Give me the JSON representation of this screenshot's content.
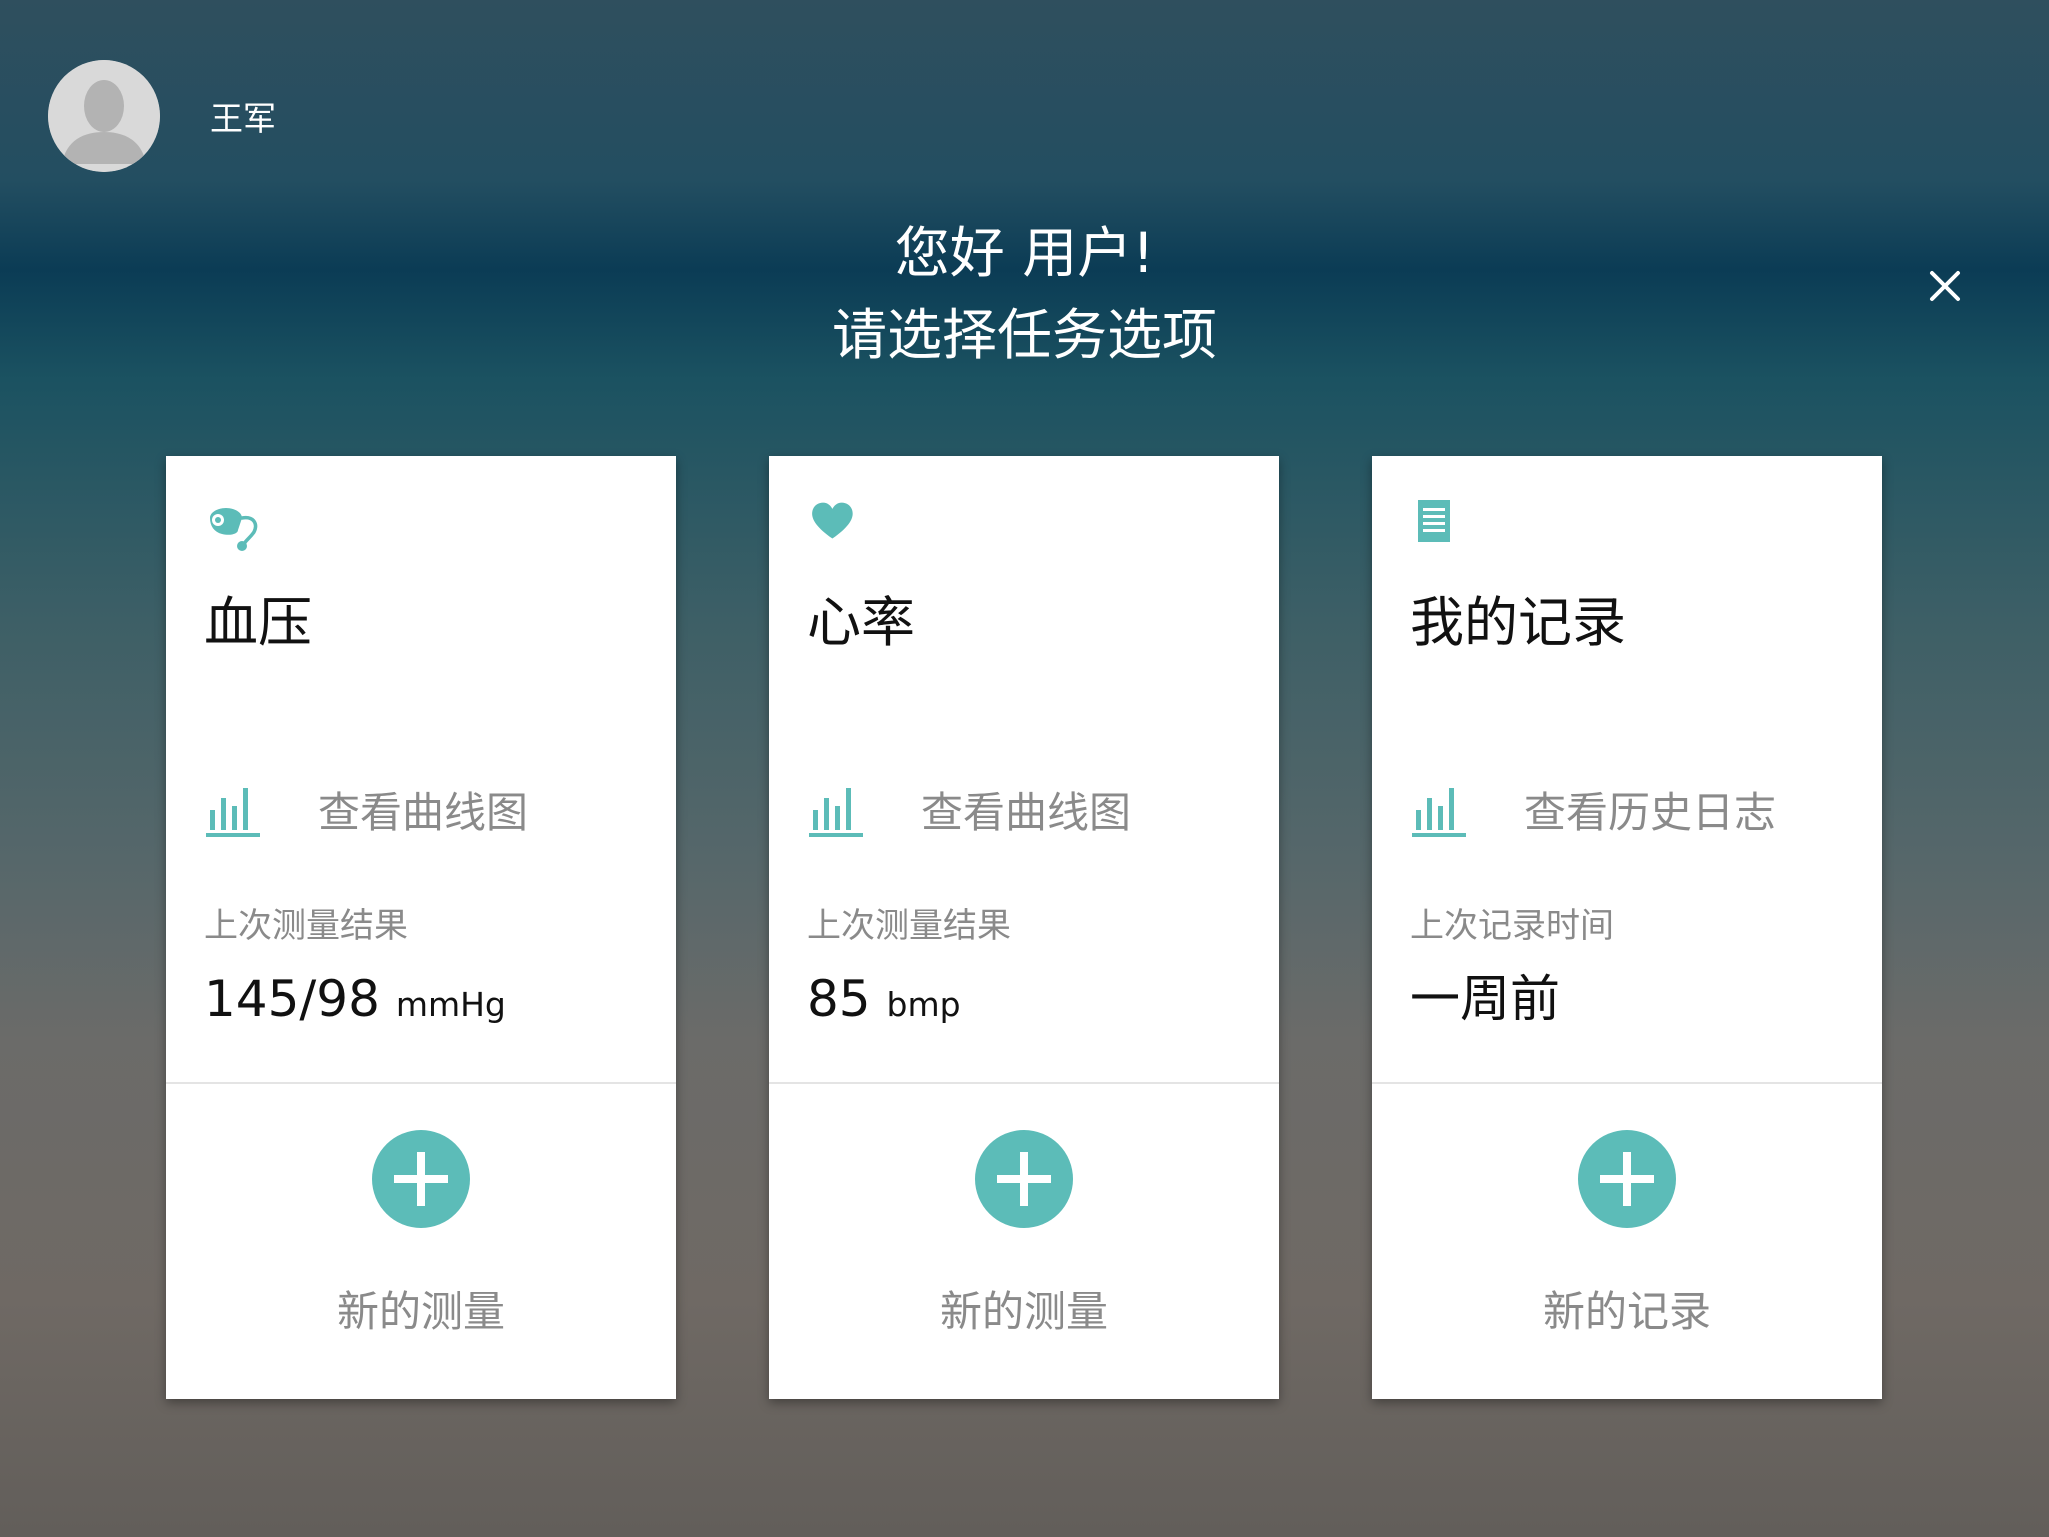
{
  "header": {
    "user_name": "王军",
    "greeting_line1": "您好 用户!",
    "greeting_line2": "请选择任务选项"
  },
  "colors": {
    "accent": "#5cbcb8",
    "card_bg": "#ffffff",
    "muted_text": "#8a8a8a"
  },
  "cards": [
    {
      "icon": "blood-pressure-cuff-icon",
      "title": "血压",
      "link_label": "查看曲线图",
      "last_label": "上次测量结果",
      "last_value": "145/98",
      "last_unit": "mmHg",
      "action_label": "新的测量"
    },
    {
      "icon": "heart-icon",
      "title": "心率",
      "link_label": "查看曲线图",
      "last_label": "上次测量结果",
      "last_value": "85",
      "last_unit": "bmp",
      "action_label": "新的测量"
    },
    {
      "icon": "document-icon",
      "title": "我的记录",
      "link_label": "查看历史日志",
      "last_label": "上次记录时间",
      "last_value": "一周前",
      "last_unit": "",
      "action_label": "新的记录"
    }
  ]
}
